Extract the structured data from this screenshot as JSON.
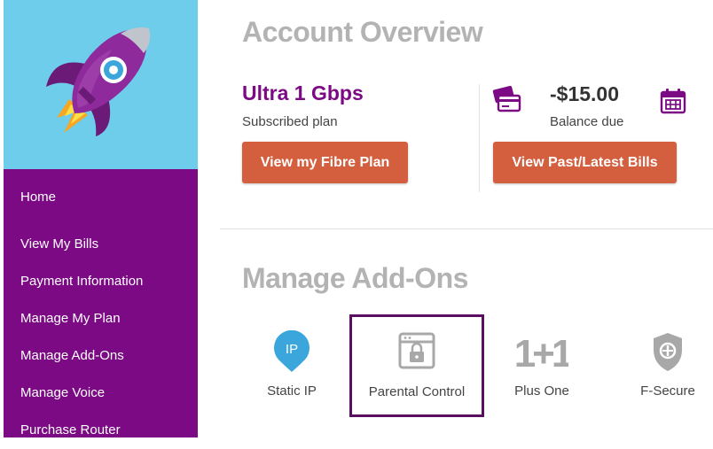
{
  "colors": {
    "brand_purple": "#7b0a84",
    "sky_blue": "#6dcdea",
    "button_orange": "#d45f3f",
    "heading_grey": "#b3b3b3",
    "addon_blue": "#3aa6dc"
  },
  "sidebar": {
    "logo_icon": "rocket-icon",
    "items": [
      {
        "label": "Home"
      },
      {
        "label": "View My Bills"
      },
      {
        "label": "Payment Information"
      },
      {
        "label": "Manage My Plan"
      },
      {
        "label": "Manage Add-Ons"
      },
      {
        "label": "Manage Voice"
      },
      {
        "label": "Purchase Router"
      }
    ]
  },
  "overview": {
    "title": "Account Overview",
    "plan_name": "Ultra 1 Gbps",
    "plan_caption": "Subscribed plan",
    "plan_button": "View my Fibre Plan",
    "balance_amount": "-$15.00",
    "balance_caption": "Balance due",
    "bills_button": "View Past/Latest Bills",
    "icons": [
      "credit-card-icon",
      "calendar-icon"
    ]
  },
  "addons": {
    "title": "Manage Add-Ons",
    "items": [
      {
        "label": "Static IP",
        "icon": "static-ip-icon",
        "icon_text": "IP",
        "selected": false
      },
      {
        "label": "Parental Control",
        "icon": "parental-lock-icon",
        "selected": true
      },
      {
        "label": "Plus One",
        "icon": "plus-one-icon",
        "icon_text": "1+1",
        "selected": false
      },
      {
        "label": "F-Secure",
        "icon": "shield-icon",
        "selected": false
      }
    ]
  }
}
